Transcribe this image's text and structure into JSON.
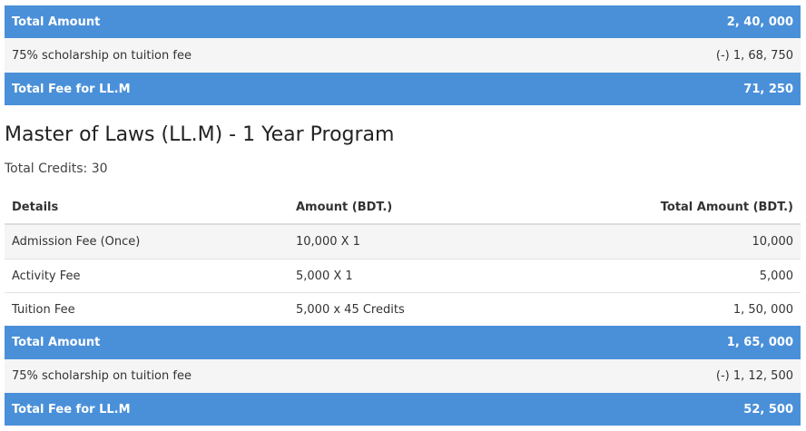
{
  "top_table": {
    "total_amount": {
      "label": "Total Amount",
      "value": "2, 40, 000"
    },
    "scholarship": {
      "label": "75% scholarship on tuition fee",
      "value": "(-) 1, 68, 750"
    },
    "total_fee": {
      "label": "Total Fee for LL.M",
      "value": "71, 250"
    }
  },
  "program": {
    "title": "Master of Laws (LL.M) - 1 Year Program",
    "credits": "Total Credits: 30"
  },
  "fee_table": {
    "headers": {
      "details": "Details",
      "amount": "Amount (BDT.)",
      "total": "Total Amount (BDT.)"
    },
    "rows": [
      {
        "details": "Admission Fee (Once)",
        "amount": "10,000 X 1",
        "total": "10,000"
      },
      {
        "details": "Activity Fee",
        "amount": "5,000 X 1",
        "total": "5,000"
      },
      {
        "details": "Tuition Fee",
        "amount": "5,000 x 45 Credits",
        "total": "1, 50, 000"
      }
    ],
    "total_amount": {
      "label": "Total Amount",
      "value": "1, 65, 000"
    },
    "scholarship": {
      "label": "75% scholarship on tuition fee",
      "value": "(-) 1, 12, 500"
    },
    "total_fee": {
      "label": "Total Fee for LL.M",
      "value": "52, 500"
    }
  },
  "colors": {
    "accent": "#4a90d9",
    "stripe": "#f5f5f5"
  }
}
